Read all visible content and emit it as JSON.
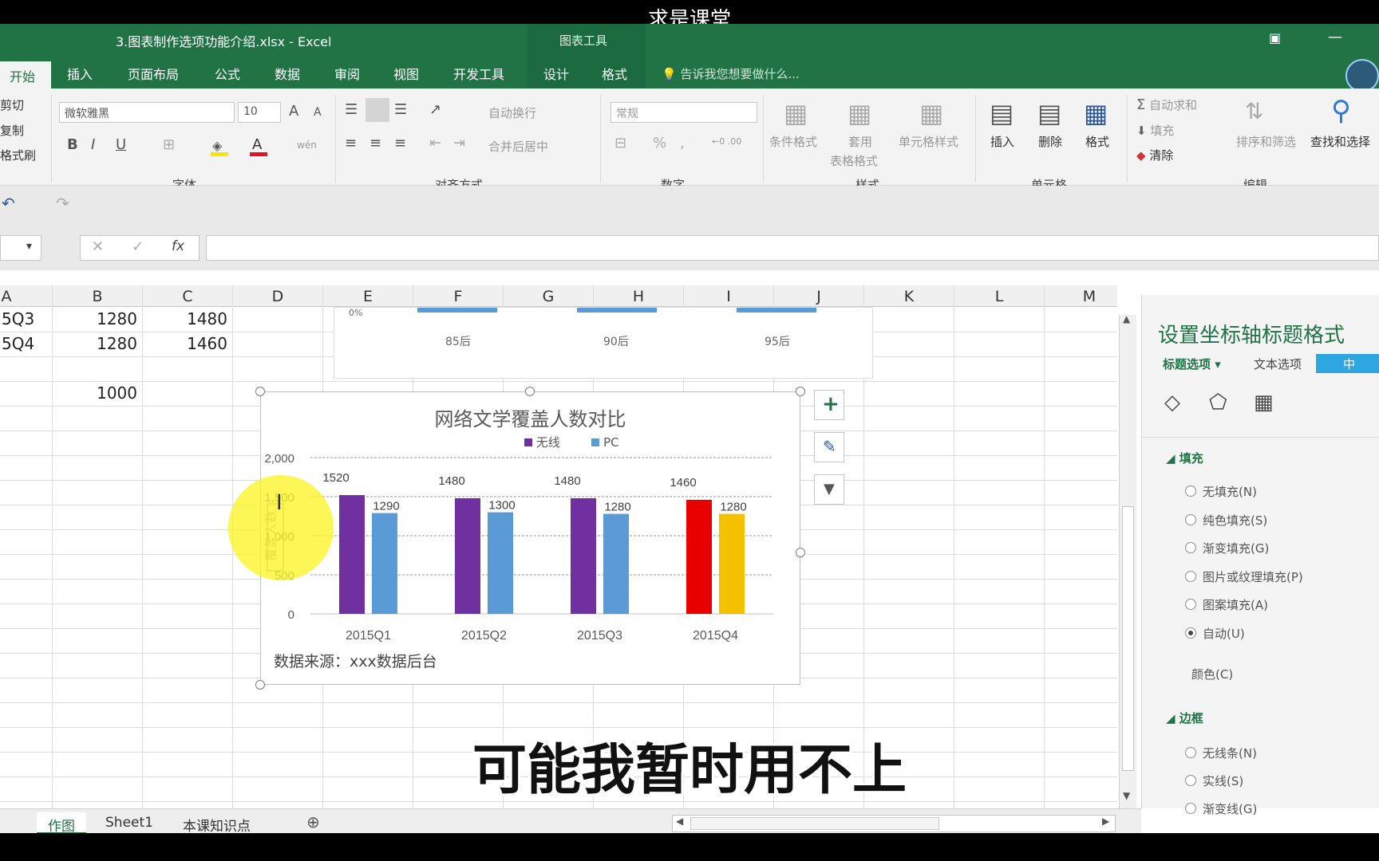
{
  "video_caption": "求是课堂",
  "subtitle": "可能我暂时用不上",
  "window": {
    "title": "3.图表制作选项功能介绍.xlsx - Excel",
    "context_group": "图表工具"
  },
  "ribbon_tabs": [
    "开始",
    "插入",
    "页面布局",
    "公式",
    "数据",
    "审阅",
    "视图",
    "开发工具",
    "设计",
    "格式"
  ],
  "tell_me": "告诉我您想要做什么...",
  "ribbon": {
    "clipboard": {
      "cut": "剪切",
      "copy": "复制",
      "painter": "格式刷"
    },
    "font": {
      "name": "微软雅黑",
      "size": "10",
      "label": "字体",
      "bold": "B",
      "italic": "I",
      "underline": "U",
      "grow": "A",
      "shrink": "A",
      "phonetic": "wén"
    },
    "align": {
      "wrap": "自动换行",
      "merge": "合并后居中",
      "label": "对齐方式"
    },
    "number": {
      "format": "常规",
      "percent": "%",
      "comma": "‚",
      "inc_dec": "←0 .00",
      "dec_dec": ".00 →0",
      "label": "数字"
    },
    "styles": {
      "cond": "条件格式",
      "table1": "套用",
      "table2": "表格格式",
      "cell": "单元格样式",
      "label": "样式"
    },
    "cells": {
      "insert": "插入",
      "delete": "删除",
      "format": "格式",
      "label": "单元格"
    },
    "editing": {
      "autosum": "自动求和",
      "fill": "填充",
      "clear": "清除",
      "sort": "排序和筛选",
      "find": "查找和选择",
      "label": "编辑"
    }
  },
  "formula": {
    "cancel": "✕",
    "enter": "✓",
    "fx": "fx"
  },
  "columns": [
    "A",
    "B",
    "C",
    "D",
    "E",
    "F",
    "G",
    "H",
    "I",
    "J",
    "K",
    "L",
    "M"
  ],
  "rows": [
    {
      "a": "5Q3",
      "b": "1280",
      "c": "1480"
    },
    {
      "a": "5Q4",
      "b": "1280",
      "c": "1460"
    },
    {
      "a": "",
      "b": "",
      "c": ""
    },
    {
      "a": "",
      "b": "1000",
      "c": ""
    }
  ],
  "chart_snippet": {
    "zero": "0%",
    "labels": [
      "85后",
      "90后",
      "95后"
    ]
  },
  "chart_data": {
    "type": "bar",
    "title": "网络文学覆盖人数对比",
    "categories": [
      "2015Q1",
      "2015Q2",
      "2015Q3",
      "2015Q4"
    ],
    "series": [
      {
        "name": "无线",
        "values": [
          1520,
          1480,
          1480,
          1460
        ],
        "color": "#7030a0"
      },
      {
        "name": "PC",
        "values": [
          1290,
          1300,
          1280,
          1280
        ],
        "color": "#5b9bd5"
      }
    ],
    "highlight_colors": {
      "2015Q4": [
        "#e80000",
        "#f5c000"
      ]
    },
    "ylim": [
      0,
      2000
    ],
    "yticks": [
      "0",
      "500",
      "1,000",
      "1,500",
      "2,000"
    ],
    "ylabel": "覆盖人数",
    "grid": true,
    "legend": "top",
    "footnote": "数据来源：xxx数据后台"
  },
  "chart_buttons": [
    "+",
    "✎",
    "▼"
  ],
  "panel": {
    "title": "设置坐标轴标题格式",
    "tab_title": "标题选项",
    "tab_text": "文本选项",
    "ime": "中",
    "fill_header": "填充",
    "fill_options": [
      "无填充(N)",
      "纯色填充(S)",
      "渐变填充(G)",
      "图片或纹理填充(P)",
      "图案填充(A)",
      "自动(U)"
    ],
    "color_label": "颜色(C)",
    "border_header": "边框",
    "border_options": [
      "无线条(N)",
      "实线(S)",
      "渐变线(G)"
    ]
  },
  "sheets": [
    "作图",
    "Sheet1",
    "本课知识点"
  ]
}
